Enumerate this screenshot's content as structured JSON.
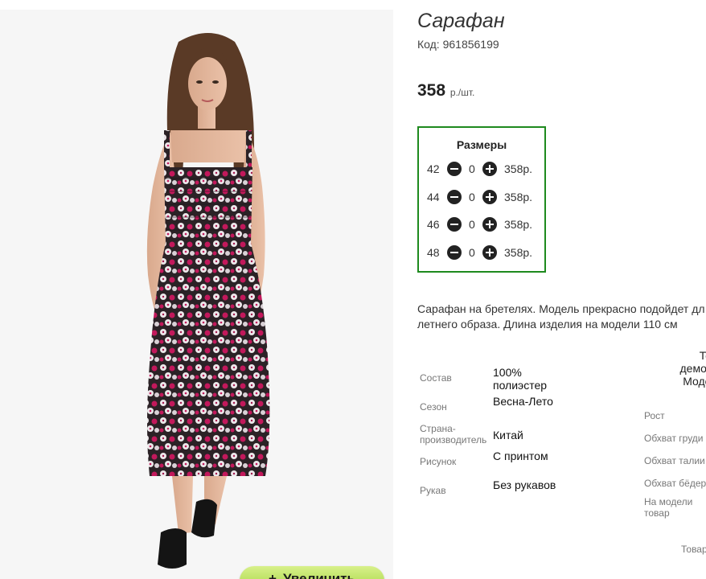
{
  "product": {
    "title": "Сарафан",
    "code": "Код: 961856199",
    "price": "358",
    "price_unit": "р./шт."
  },
  "zoom_button": {
    "icon": "plus-icon",
    "label": "Увеличить"
  },
  "sizes": {
    "title": "Размеры",
    "rows": [
      {
        "size": "42",
        "qty": "0",
        "price": "358р."
      },
      {
        "size": "44",
        "qty": "0",
        "price": "358р."
      },
      {
        "size": "46",
        "qty": "0",
        "price": "358р."
      },
      {
        "size": "48",
        "qty": "0",
        "price": "358р."
      }
    ]
  },
  "description": {
    "line1": "Сарафан на бретелях. Модель прекрасно подойдет дл",
    "line2": "летнего образа. Длина изделия на модели 110 см"
  },
  "specs": [
    {
      "label": "Состав",
      "value": "100% полиэстер"
    },
    {
      "label": "Сезон",
      "value": "Весна-Лето"
    },
    {
      "label": "Страна-производитель",
      "value": "Китай"
    },
    {
      "label": "Рисунок",
      "value": "С принтом"
    },
    {
      "label": "Рукав",
      "value": "Без рукавов"
    }
  ],
  "model_params": {
    "heading_line1": "Това",
    "heading_line2": "демонст",
    "heading_line3": "Модели",
    "labels": [
      "Рост",
      "Обхват груди",
      "Обхват талии",
      "Обхват бёдер",
      "На модели товар"
    ],
    "trailing": "Товар"
  },
  "colors": {
    "sizes_border": "#1e8a1e",
    "zoom_button": "#b5e05a",
    "dress_base": "#2b2226",
    "print_pink": "#c2185b",
    "print_white": "#ece7ea"
  }
}
